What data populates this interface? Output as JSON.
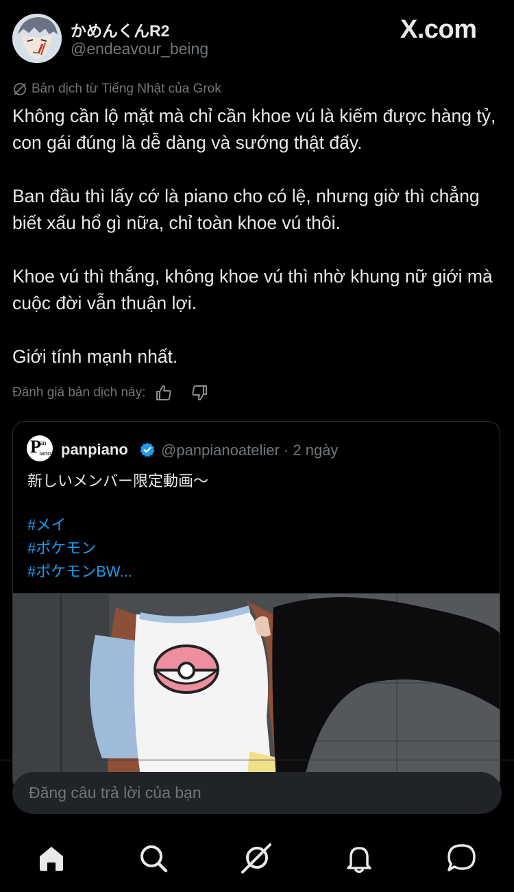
{
  "header": {
    "user_name": "かめんくんR2",
    "user_handle": "@endeavour_being",
    "logo_text": "X.com"
  },
  "translation": {
    "note": "Bản dịch từ Tiếng Nhật của Grok",
    "paragraphs": [
      "Không cần lộ mặt mà chỉ cần khoe vú là kiếm được hàng tỷ, con gái đúng là dễ dàng và sướng thật đấy.",
      "Ban đầu thì lấy cớ là piano cho có lệ, nhưng giờ thì chẳng biết xấu hổ gì nữa, chỉ toàn khoe vú thôi.",
      "Khoe vú thì thắng, không khoe vú thì nhờ khung nữ giới mà cuộc đời vẫn thuận lợi.",
      "Giới tính mạnh nhất."
    ],
    "rate_label": "Đánh giá bản dịch này:"
  },
  "quote": {
    "avatar_letter": "P",
    "avatar_small_1": "an",
    "avatar_small_2": "iano",
    "name": "panpiano",
    "handle": "@panpianoatelier",
    "separator": "·",
    "time": "2 ngày",
    "text": "新しいメンバー限定動画〜",
    "hashtags": [
      "#メイ",
      "#ポケモン",
      "#ポケモンBW..."
    ]
  },
  "reply": {
    "placeholder": "Đăng câu trả lời của bạn"
  },
  "nav": {
    "items": [
      "home-icon",
      "search-icon",
      "grok-icon",
      "notifications-icon",
      "messages-icon"
    ]
  },
  "colors": {
    "background": "#000000",
    "text": "#e7e9ea",
    "muted": "#71767b",
    "link": "#1d9bf0",
    "border": "#2f3336"
  }
}
